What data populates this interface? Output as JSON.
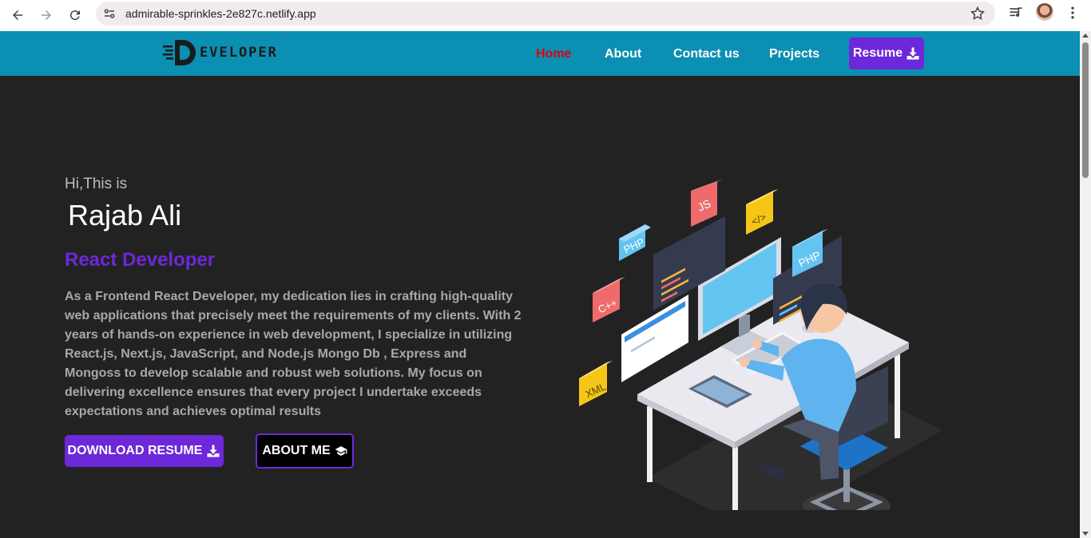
{
  "browser": {
    "url": "admirable-sprinkles-2e827c.netlify.app"
  },
  "header": {
    "logo_text": "EVELOPER",
    "logo_letter": "D",
    "nav": [
      {
        "label": "Home",
        "active": true
      },
      {
        "label": "About",
        "active": false
      },
      {
        "label": "Contact us",
        "active": false
      },
      {
        "label": "Projects",
        "active": false
      }
    ],
    "resume_label": "Resume"
  },
  "hero": {
    "greeting": "Hi,This is",
    "name": "Rajab Ali",
    "role": "React Developer",
    "bio": "As a Frontend React Developer, my dedication lies in crafting high-quality web applications that precisely meet the requirements of my clients. With 2 years of hands-on experience in web development, I specialize in utilizing React.js, Next.js, JavaScript, and Node.js Mongo Db , Express and Mongoss to develop scalable and robust web solutions. My focus on delivering excellence ensures that every project I undertake exceeds expectations and achieves optimal results",
    "download_label": "DOWNLOAD RESUME",
    "about_label": "ABOUT ME"
  },
  "illustration": {
    "badges": [
      "PHP",
      "JS",
      "</>",
      "PHP",
      "C++",
      "XML"
    ]
  },
  "colors": {
    "header_bg": "#0b8fb3",
    "accent": "#6d28d9",
    "active_nav": "#e0000a",
    "page_bg": "#222222"
  }
}
